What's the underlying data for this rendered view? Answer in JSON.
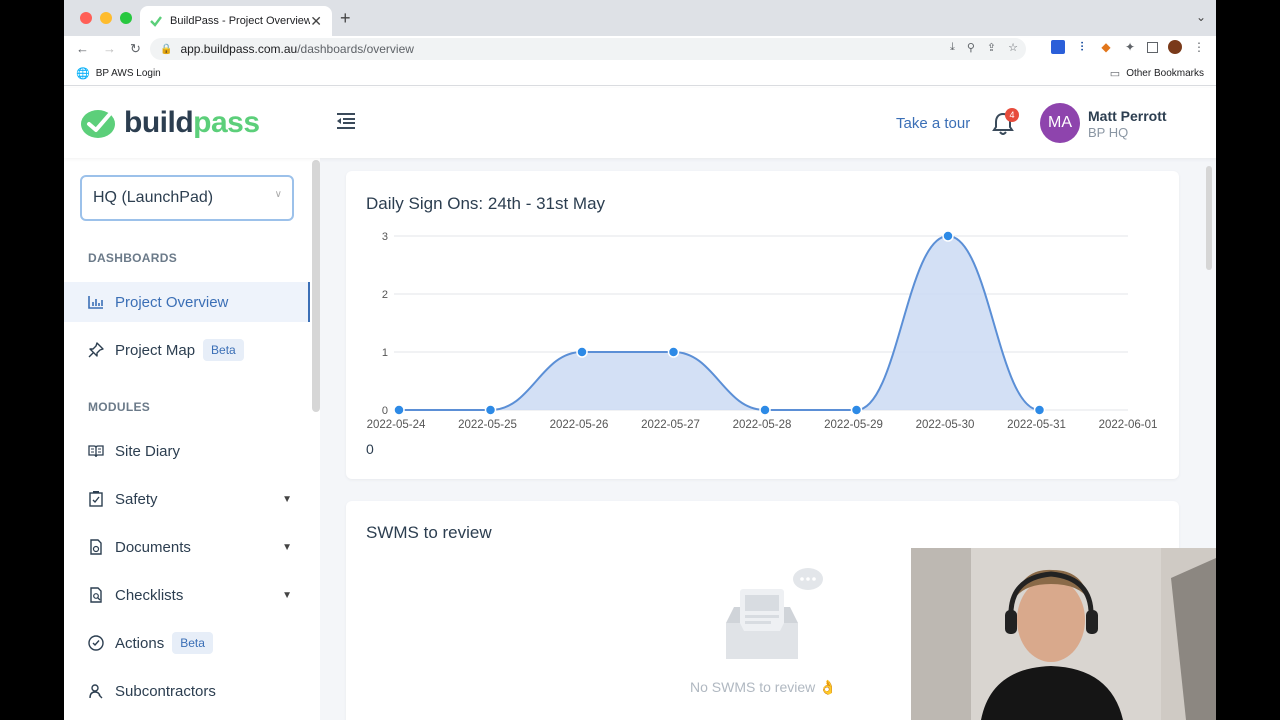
{
  "browser": {
    "tab_title": "BuildPass - Project Overview",
    "url_host": "app.buildpass.com.au",
    "url_path": "/dashboards/overview",
    "bookmark_left": "BP AWS Login",
    "bookmark_right": "Other Bookmarks"
  },
  "header": {
    "logo_part1": "build",
    "logo_part2": "pass",
    "tour_label": "Take a tour",
    "notification_count": "4",
    "avatar_initials": "MA",
    "user_name": "Matt Perrott",
    "user_org": "BP HQ"
  },
  "sidebar": {
    "project": "HQ (LaunchPad)",
    "dashboards_label": "DASHBOARDS",
    "modules_label": "MODULES",
    "items": [
      {
        "label": "Project Overview",
        "icon": "bar-chart-icon"
      },
      {
        "label": "Project Map",
        "icon": "pin-icon",
        "badge": "Beta"
      },
      {
        "label": "Site Diary",
        "icon": "book-icon"
      },
      {
        "label": "Safety",
        "icon": "clipboard-check-icon"
      },
      {
        "label": "Documents",
        "icon": "document-icon"
      },
      {
        "label": "Checklists",
        "icon": "checklist-icon"
      },
      {
        "label": "Actions",
        "icon": "check-circle-icon",
        "badge": "Beta"
      },
      {
        "label": "Subcontractors",
        "icon": "people-icon"
      }
    ]
  },
  "main": {
    "chart_card_title": "Daily Sign Ons: 24th - 31st May",
    "chart_total": "0",
    "swms_title": "SWMS to review",
    "swms_empty": "No SWMS to review 👌"
  },
  "chart_data": {
    "type": "area",
    "title": "Daily Sign Ons: 24th - 31st May",
    "x": [
      "2022-05-24",
      "2022-05-25",
      "2022-05-26",
      "2022-05-27",
      "2022-05-28",
      "2022-05-29",
      "2022-05-30",
      "2022-05-31",
      "2022-06-01"
    ],
    "values": [
      0,
      0,
      1,
      1,
      0,
      0,
      3,
      0
    ],
    "yticks": [
      "0",
      "1",
      "2",
      "3"
    ],
    "ylim": [
      0,
      3
    ],
    "grid": true,
    "line_color": "#5b8fd6",
    "fill_color": "#cbdaf3",
    "point_color": "#2d8ae6"
  },
  "colors": {
    "accent": "#3b6fb6",
    "brand_green": "#5ccf7a",
    "avatar": "#8e44ad",
    "badge": "#e74c3c"
  }
}
